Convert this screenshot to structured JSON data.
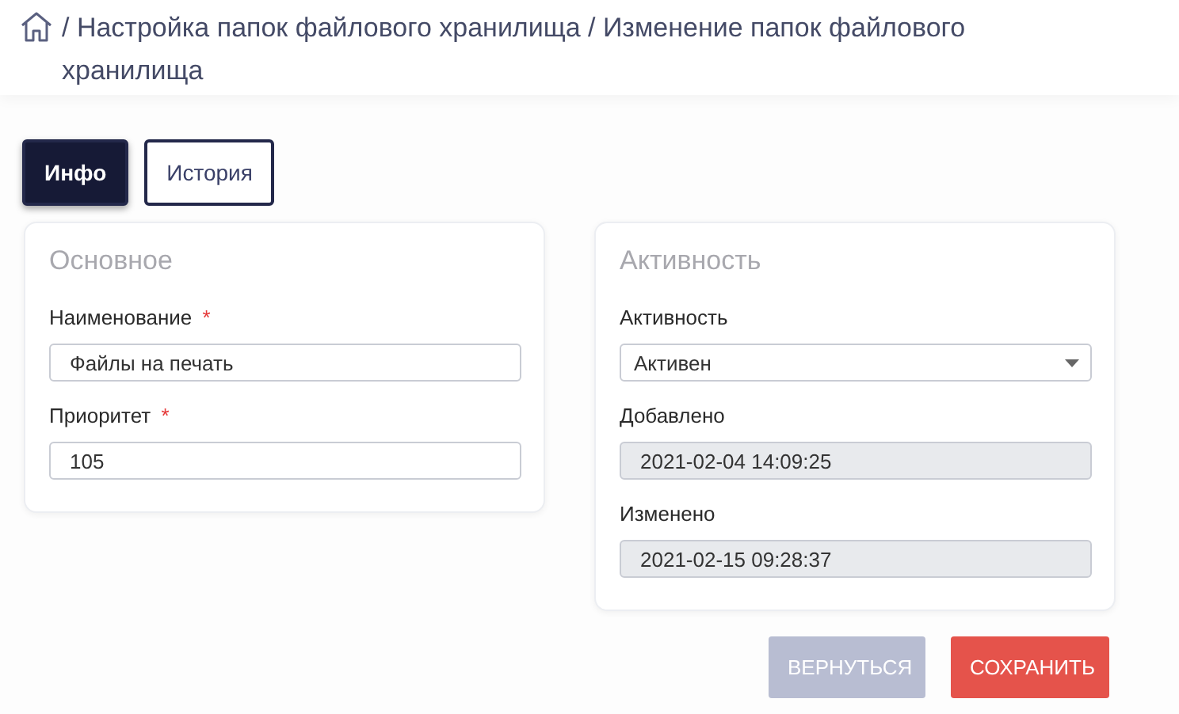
{
  "breadcrumb": {
    "path": "/ Настройка папок файлового хранилища / Изменение папок файлового хранилища"
  },
  "tabs": [
    {
      "label": "Инфо",
      "selected": true
    },
    {
      "label": "История",
      "selected": false
    }
  ],
  "cards": [
    {
      "title": "Основное",
      "fields": [
        {
          "kind": "text",
          "label": "Наименование",
          "required_mark": "*",
          "value": "Файлы на печать"
        },
        {
          "kind": "text",
          "label": "Приоритет",
          "required_mark": "*",
          "value": "105"
        }
      ]
    },
    {
      "title": "Активность",
      "fields": [
        {
          "kind": "select",
          "label": "Активность",
          "value": "Активен"
        },
        {
          "kind": "readonly",
          "label": "Добавлено",
          "value": "2021-02-04 14:09:25"
        },
        {
          "kind": "readonly",
          "label": "Изменено",
          "value": "2021-02-15 09:28:37"
        }
      ]
    }
  ],
  "buttons": [
    {
      "kind": "secondary",
      "label": "ВЕРНУТЬСЯ"
    },
    {
      "kind": "primary",
      "label": "СОХРАНИТЬ"
    }
  ]
}
